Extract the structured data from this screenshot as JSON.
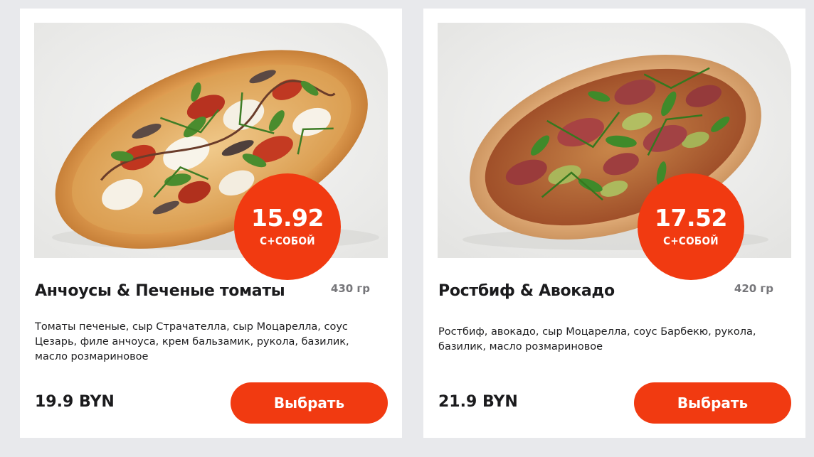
{
  "products": [
    {
      "title": "Анчоусы & Печеные томаты",
      "weight": "430 гр",
      "description": "Томаты печеные, сыр Страчателла, сыр Моцарелла, соус Цезарь, филе анчоуса, крем бальзамик, рукола, базилик, масло розмариновое",
      "price": "19.9 BYN",
      "takeaway_price": "15.92",
      "takeaway_label": "С+СОБОЙ",
      "button_label": "Выбрать",
      "image": "pizza-anchovies-image"
    },
    {
      "title": "Ростбиф & Авокадо",
      "weight": "420 гр",
      "description": "Ростбиф, авокадо, сыр Моцарелла, соус Барбекю, рукола, базилик, масло розмариновое",
      "price": "21.9 BYN",
      "takeaway_price": "17.52",
      "takeaway_label": "С+СОБОЙ",
      "button_label": "Выбрать",
      "image": "pizza-roastbeef-image"
    }
  ],
  "colors": {
    "accent": "#f13a11",
    "page_background": "#e8e9ec",
    "card_background": "#ffffff",
    "text": "#1b1b1d",
    "muted": "#76767a"
  }
}
